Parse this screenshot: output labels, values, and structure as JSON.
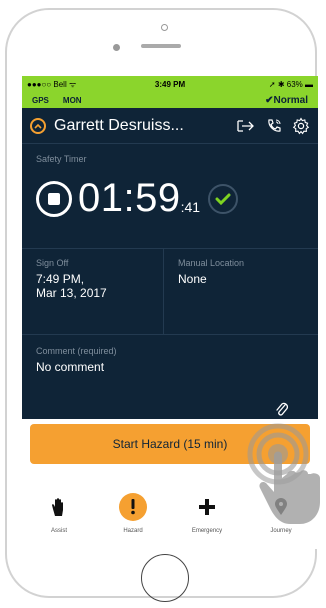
{
  "status_bar": {
    "carrier": "●●●○○ Bell ᯤ",
    "time": "3:49 PM",
    "right": "➚ ✱ 63% ▬"
  },
  "gps_bar": {
    "gps": "GPS",
    "day": "MON",
    "status": "✔Normal"
  },
  "header": {
    "name": "Garrett Desruiss...",
    "icons": [
      "warning-icon",
      "logout-icon",
      "phone-call-icon",
      "gear-icon"
    ]
  },
  "timer": {
    "label": "Safety Timer",
    "main": "01:59",
    "seconds": ":41"
  },
  "sign_off": {
    "label": "Sign Off",
    "value_line1": "7:49 PM,",
    "value_line2": "Mar 13, 2017"
  },
  "manual_location": {
    "label": "Manual Location",
    "value": "None"
  },
  "comment": {
    "label": "Comment (required)",
    "value": "No comment"
  },
  "action_button": {
    "label": "Start Hazard (15 min)"
  },
  "tabs": [
    {
      "label": "Assist",
      "icon": "hand-icon"
    },
    {
      "label": "Hazard",
      "icon": "hazard-icon"
    },
    {
      "label": "Emergency",
      "icon": "plus-icon"
    },
    {
      "label": "Journey",
      "icon": "map-pin-icon"
    }
  ],
  "colors": {
    "accent_green": "#8bd52c",
    "card_bg": "#0f2437",
    "accent_orange": "#f5a031",
    "check_green": "#7ed321"
  }
}
